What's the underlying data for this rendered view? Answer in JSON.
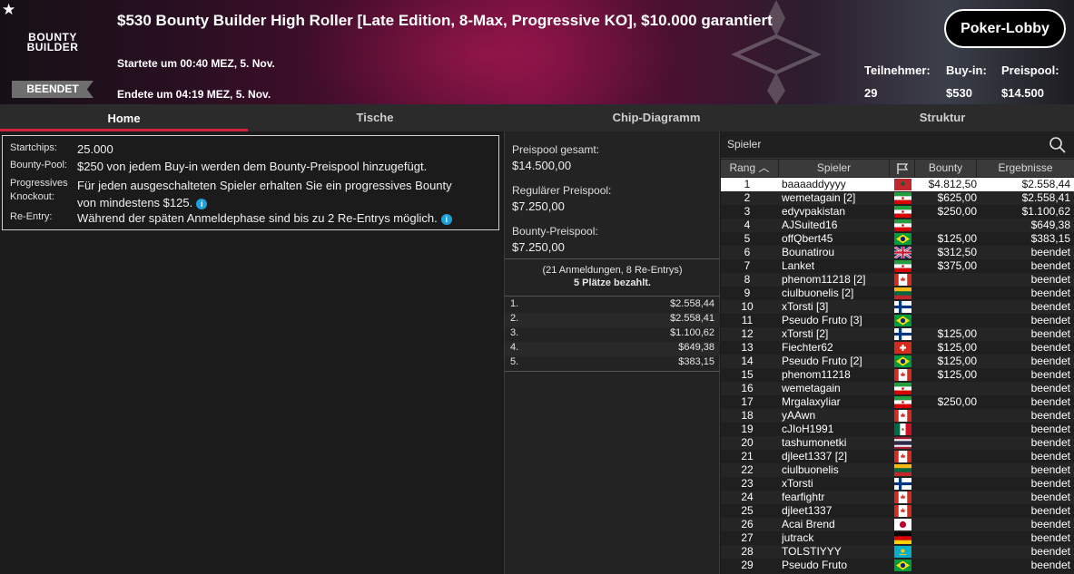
{
  "header": {
    "logo_line1": "BOUNTY",
    "logo_line2": "BUILDER",
    "status": "BEENDET",
    "title": "$530 Bounty Builder High Roller [Late Edition, 8-Max, Progressive KO], $10.000 garantiert",
    "started": "Startete um 00:40 MEZ, 5. Nov.",
    "ended": "Endete um 04:19 MEZ, 5. Nov.",
    "lobby_button": "Poker-Lobby",
    "stats": [
      {
        "label": "Teilnehmer:",
        "value": "29"
      },
      {
        "label": "Buy-in:",
        "value": "$530"
      },
      {
        "label": "Preispool:",
        "value": "$14.500"
      }
    ]
  },
  "tabs": [
    "Home",
    "Tische",
    "Chip-Diagramm",
    "Struktur"
  ],
  "info": {
    "startchips_label": "Startchips:",
    "startchips_value": "25.000",
    "bountypool_label": "Bounty-Pool:",
    "bountypool_value": "$250 von jedem Buy-in werden dem Bounty-Preispool hinzugefügt.",
    "pko_label_1": "Progressives",
    "pko_label_2": "Knockout:",
    "pko_value_1": "Für jeden ausgeschalteten Spieler erhalten Sie ein progressives Bounty",
    "pko_value_2": "von mindestens $125.",
    "reentry_label": "Re-Entry:",
    "reentry_value": "Während der späten Anmeldephase sind bis zu 2 Re-Entrys möglich."
  },
  "prizepool": {
    "total_label": "Preispool gesamt:",
    "total_value": "$14.500,00",
    "regular_label": "Regulärer Preispool:",
    "regular_value": "$7.250,00",
    "bounty_label": "Bounty-Preispool:",
    "bounty_value": "$7.250,00",
    "registrations": "(21 Anmeldungen, 8 Re-Entrys)",
    "paid_places": "5 Plätze bezahlt.",
    "payouts": [
      {
        "pos": "1.",
        "amount": "$2.558,44"
      },
      {
        "pos": "2.",
        "amount": "$2.558,41"
      },
      {
        "pos": "3.",
        "amount": "$1.100,62"
      },
      {
        "pos": "4.",
        "amount": "$649,38"
      },
      {
        "pos": "5.",
        "amount": "$383,15"
      }
    ]
  },
  "players": {
    "search_placeholder": "Spieler",
    "columns": {
      "rank": "Rang",
      "player": "Spieler",
      "bounty": "Bounty",
      "result": "Ergebnisse"
    },
    "rows": [
      {
        "rank": "1",
        "name": "baaaaddyyyy",
        "flag": "morocco",
        "bounty": "$4.812,50",
        "result": "$2.558,44"
      },
      {
        "rank": "2",
        "name": "wemetagain [2]",
        "flag": "iran",
        "bounty": "$625,00",
        "result": "$2.558,41"
      },
      {
        "rank": "3",
        "name": "edyvpakistan",
        "flag": "iran",
        "bounty": "$250,00",
        "result": "$1.100,62"
      },
      {
        "rank": "4",
        "name": "AJSuited16",
        "flag": "iran",
        "bounty": "",
        "result": "$649,38"
      },
      {
        "rank": "5",
        "name": "offQbert45",
        "flag": "brazil",
        "bounty": "$125,00",
        "result": "$383,15"
      },
      {
        "rank": "6",
        "name": "Bounatirou",
        "flag": "uk",
        "bounty": "$312,50",
        "result": "beendet"
      },
      {
        "rank": "7",
        "name": "Lanket",
        "flag": "iran",
        "bounty": "$375,00",
        "result": "beendet"
      },
      {
        "rank": "8",
        "name": "phenom11218 [2]",
        "flag": "canada",
        "bounty": "",
        "result": "beendet"
      },
      {
        "rank": "9",
        "name": "ciulbuonelis [2]",
        "flag": "lithuania",
        "bounty": "",
        "result": "beendet"
      },
      {
        "rank": "10",
        "name": "xTorsti [3]",
        "flag": "finland",
        "bounty": "",
        "result": "beendet"
      },
      {
        "rank": "11",
        "name": "Pseudo Fruto [3]",
        "flag": "brazil",
        "bounty": "",
        "result": "beendet"
      },
      {
        "rank": "12",
        "name": "xTorsti [2]",
        "flag": "finland",
        "bounty": "$125,00",
        "result": "beendet"
      },
      {
        "rank": "13",
        "name": "Fiechter62",
        "flag": "switzerland",
        "bounty": "$125,00",
        "result": "beendet"
      },
      {
        "rank": "14",
        "name": "Pseudo Fruto [2]",
        "flag": "brazil",
        "bounty": "$125,00",
        "result": "beendet"
      },
      {
        "rank": "15",
        "name": "phenom11218",
        "flag": "canada",
        "bounty": "$125,00",
        "result": "beendet"
      },
      {
        "rank": "16",
        "name": "wemetagain",
        "flag": "iran",
        "bounty": "",
        "result": "beendet"
      },
      {
        "rank": "17",
        "name": "Mrgalaxyliar",
        "flag": "iran",
        "bounty": "$250,00",
        "result": "beendet"
      },
      {
        "rank": "18",
        "name": "yAAwn",
        "flag": "canada",
        "bounty": "",
        "result": "beendet"
      },
      {
        "rank": "19",
        "name": "cJIoH1991",
        "flag": "mexico",
        "bounty": "",
        "result": "beendet"
      },
      {
        "rank": "20",
        "name": "tashumonetki",
        "flag": "thailand",
        "bounty": "",
        "result": "beendet"
      },
      {
        "rank": "21",
        "name": "djleet1337 [2]",
        "flag": "canada",
        "bounty": "",
        "result": "beendet"
      },
      {
        "rank": "22",
        "name": "ciulbuonelis",
        "flag": "lithuania",
        "bounty": "",
        "result": "beendet"
      },
      {
        "rank": "23",
        "name": "xTorsti",
        "flag": "finland",
        "bounty": "",
        "result": "beendet"
      },
      {
        "rank": "24",
        "name": "fearfightr",
        "flag": "canada",
        "bounty": "",
        "result": "beendet"
      },
      {
        "rank": "25",
        "name": "djleet1337",
        "flag": "canada",
        "bounty": "",
        "result": "beendet"
      },
      {
        "rank": "26",
        "name": "Acai Brend",
        "flag": "japan",
        "bounty": "",
        "result": "beendet"
      },
      {
        "rank": "27",
        "name": "jutrack",
        "flag": "germany",
        "bounty": "",
        "result": "beendet"
      },
      {
        "rank": "28",
        "name": "TOLSTIYYY",
        "flag": "kazakhstan",
        "bounty": "",
        "result": "beendet"
      },
      {
        "rank": "29",
        "name": "Pseudo Fruto",
        "flag": "brazil",
        "bounty": "",
        "result": "beendet"
      }
    ]
  }
}
